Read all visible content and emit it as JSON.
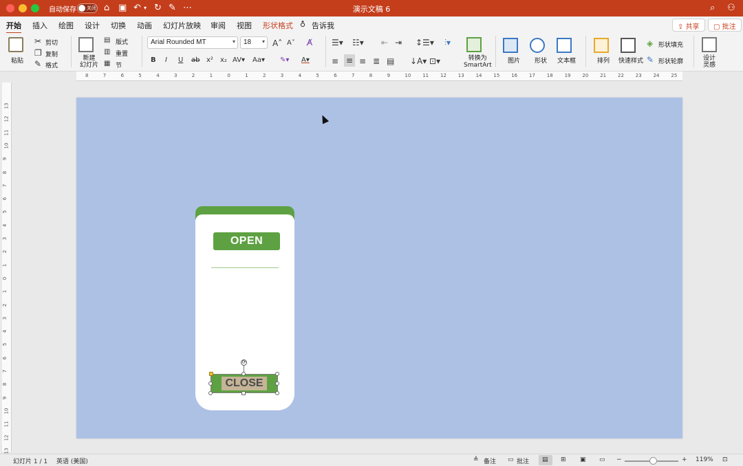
{
  "titlebar": {
    "autosave_label": "自动保存",
    "autosave_state": "关闭",
    "doc_title": "演示文稿 6"
  },
  "tabs": [
    {
      "label": "开始"
    },
    {
      "label": "插入"
    },
    {
      "label": "绘图"
    },
    {
      "label": "设计"
    },
    {
      "label": "切换"
    },
    {
      "label": "动画"
    },
    {
      "label": "幻灯片放映"
    },
    {
      "label": "审阅"
    },
    {
      "label": "视图"
    },
    {
      "label": "形状格式"
    },
    {
      "label": "告诉我"
    }
  ],
  "actions": {
    "share": "共享",
    "comment": "批注"
  },
  "ribbon": {
    "paste": "粘贴",
    "cut": "剪切",
    "copy": "复制",
    "format": "格式",
    "new_slide": "新建\n幻灯片",
    "layout": "版式",
    "reset": "重置",
    "section": "节",
    "font_name": "Arial Rounded MT",
    "font_size": "18",
    "convert_smartart": "转换为\nSmartArt",
    "picture": "图片",
    "shape": "形状",
    "textbox": "文本框",
    "arrange": "排列",
    "quick_styles": "快速样式",
    "shape_fill": "形状填充",
    "shape_outline": "形状轮廓",
    "design_ideas": "设计\n灵感"
  },
  "slide": {
    "open_label": "OPEN",
    "close_label": "CLOSE"
  },
  "ruler_labels": [
    "8",
    "7",
    "6",
    "5",
    "4",
    "3",
    "2",
    "1",
    "0",
    "1",
    "2",
    "3",
    "4",
    "5",
    "6",
    "7",
    "8",
    "9",
    "10",
    "11",
    "12",
    "13",
    "14",
    "15",
    "16",
    "17",
    "18",
    "19",
    "20",
    "21",
    "22",
    "23",
    "24",
    "25"
  ],
  "vruler_labels": [
    "13",
    "12",
    "11",
    "10",
    "9",
    "8",
    "7",
    "6",
    "5",
    "4",
    "3",
    "2",
    "1",
    "0",
    "1",
    "2",
    "3",
    "4",
    "5",
    "6",
    "7",
    "8",
    "9",
    "10",
    "11",
    "12",
    "13"
  ],
  "status": {
    "slide_count": "幻灯片 1 / 1",
    "language": "英语 (美国)",
    "notes": "备注",
    "comments": "批注",
    "zoom": "119%"
  },
  "colors": {
    "titlebar": "#c43e1c",
    "slide_bg": "#adc1e5",
    "card_green": "#5ea142",
    "close_fill": "#c5b596"
  }
}
